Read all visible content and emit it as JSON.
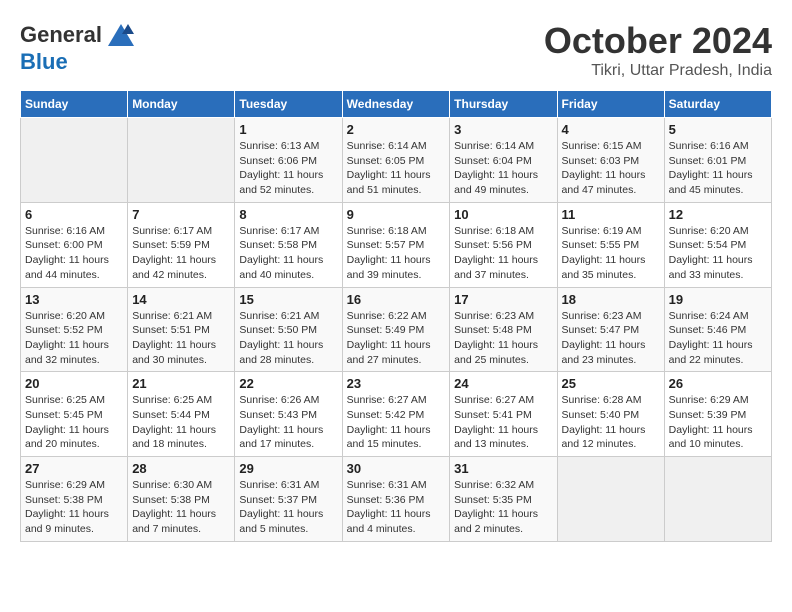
{
  "header": {
    "logo_line1": "General",
    "logo_line2": "Blue",
    "month_year": "October 2024",
    "location": "Tikri, Uttar Pradesh, India"
  },
  "days_of_week": [
    "Sunday",
    "Monday",
    "Tuesday",
    "Wednesday",
    "Thursday",
    "Friday",
    "Saturday"
  ],
  "weeks": [
    [
      {
        "day": "",
        "info": ""
      },
      {
        "day": "",
        "info": ""
      },
      {
        "day": "1",
        "info": "Sunrise: 6:13 AM\nSunset: 6:06 PM\nDaylight: 11 hours and 52 minutes."
      },
      {
        "day": "2",
        "info": "Sunrise: 6:14 AM\nSunset: 6:05 PM\nDaylight: 11 hours and 51 minutes."
      },
      {
        "day": "3",
        "info": "Sunrise: 6:14 AM\nSunset: 6:04 PM\nDaylight: 11 hours and 49 minutes."
      },
      {
        "day": "4",
        "info": "Sunrise: 6:15 AM\nSunset: 6:03 PM\nDaylight: 11 hours and 47 minutes."
      },
      {
        "day": "5",
        "info": "Sunrise: 6:16 AM\nSunset: 6:01 PM\nDaylight: 11 hours and 45 minutes."
      }
    ],
    [
      {
        "day": "6",
        "info": "Sunrise: 6:16 AM\nSunset: 6:00 PM\nDaylight: 11 hours and 44 minutes."
      },
      {
        "day": "7",
        "info": "Sunrise: 6:17 AM\nSunset: 5:59 PM\nDaylight: 11 hours and 42 minutes."
      },
      {
        "day": "8",
        "info": "Sunrise: 6:17 AM\nSunset: 5:58 PM\nDaylight: 11 hours and 40 minutes."
      },
      {
        "day": "9",
        "info": "Sunrise: 6:18 AM\nSunset: 5:57 PM\nDaylight: 11 hours and 39 minutes."
      },
      {
        "day": "10",
        "info": "Sunrise: 6:18 AM\nSunset: 5:56 PM\nDaylight: 11 hours and 37 minutes."
      },
      {
        "day": "11",
        "info": "Sunrise: 6:19 AM\nSunset: 5:55 PM\nDaylight: 11 hours and 35 minutes."
      },
      {
        "day": "12",
        "info": "Sunrise: 6:20 AM\nSunset: 5:54 PM\nDaylight: 11 hours and 33 minutes."
      }
    ],
    [
      {
        "day": "13",
        "info": "Sunrise: 6:20 AM\nSunset: 5:52 PM\nDaylight: 11 hours and 32 minutes."
      },
      {
        "day": "14",
        "info": "Sunrise: 6:21 AM\nSunset: 5:51 PM\nDaylight: 11 hours and 30 minutes."
      },
      {
        "day": "15",
        "info": "Sunrise: 6:21 AM\nSunset: 5:50 PM\nDaylight: 11 hours and 28 minutes."
      },
      {
        "day": "16",
        "info": "Sunrise: 6:22 AM\nSunset: 5:49 PM\nDaylight: 11 hours and 27 minutes."
      },
      {
        "day": "17",
        "info": "Sunrise: 6:23 AM\nSunset: 5:48 PM\nDaylight: 11 hours and 25 minutes."
      },
      {
        "day": "18",
        "info": "Sunrise: 6:23 AM\nSunset: 5:47 PM\nDaylight: 11 hours and 23 minutes."
      },
      {
        "day": "19",
        "info": "Sunrise: 6:24 AM\nSunset: 5:46 PM\nDaylight: 11 hours and 22 minutes."
      }
    ],
    [
      {
        "day": "20",
        "info": "Sunrise: 6:25 AM\nSunset: 5:45 PM\nDaylight: 11 hours and 20 minutes."
      },
      {
        "day": "21",
        "info": "Sunrise: 6:25 AM\nSunset: 5:44 PM\nDaylight: 11 hours and 18 minutes."
      },
      {
        "day": "22",
        "info": "Sunrise: 6:26 AM\nSunset: 5:43 PM\nDaylight: 11 hours and 17 minutes."
      },
      {
        "day": "23",
        "info": "Sunrise: 6:27 AM\nSunset: 5:42 PM\nDaylight: 11 hours and 15 minutes."
      },
      {
        "day": "24",
        "info": "Sunrise: 6:27 AM\nSunset: 5:41 PM\nDaylight: 11 hours and 13 minutes."
      },
      {
        "day": "25",
        "info": "Sunrise: 6:28 AM\nSunset: 5:40 PM\nDaylight: 11 hours and 12 minutes."
      },
      {
        "day": "26",
        "info": "Sunrise: 6:29 AM\nSunset: 5:39 PM\nDaylight: 11 hours and 10 minutes."
      }
    ],
    [
      {
        "day": "27",
        "info": "Sunrise: 6:29 AM\nSunset: 5:38 PM\nDaylight: 11 hours and 9 minutes."
      },
      {
        "day": "28",
        "info": "Sunrise: 6:30 AM\nSunset: 5:38 PM\nDaylight: 11 hours and 7 minutes."
      },
      {
        "day": "29",
        "info": "Sunrise: 6:31 AM\nSunset: 5:37 PM\nDaylight: 11 hours and 5 minutes."
      },
      {
        "day": "30",
        "info": "Sunrise: 6:31 AM\nSunset: 5:36 PM\nDaylight: 11 hours and 4 minutes."
      },
      {
        "day": "31",
        "info": "Sunrise: 6:32 AM\nSunset: 5:35 PM\nDaylight: 11 hours and 2 minutes."
      },
      {
        "day": "",
        "info": ""
      },
      {
        "day": "",
        "info": ""
      }
    ]
  ]
}
